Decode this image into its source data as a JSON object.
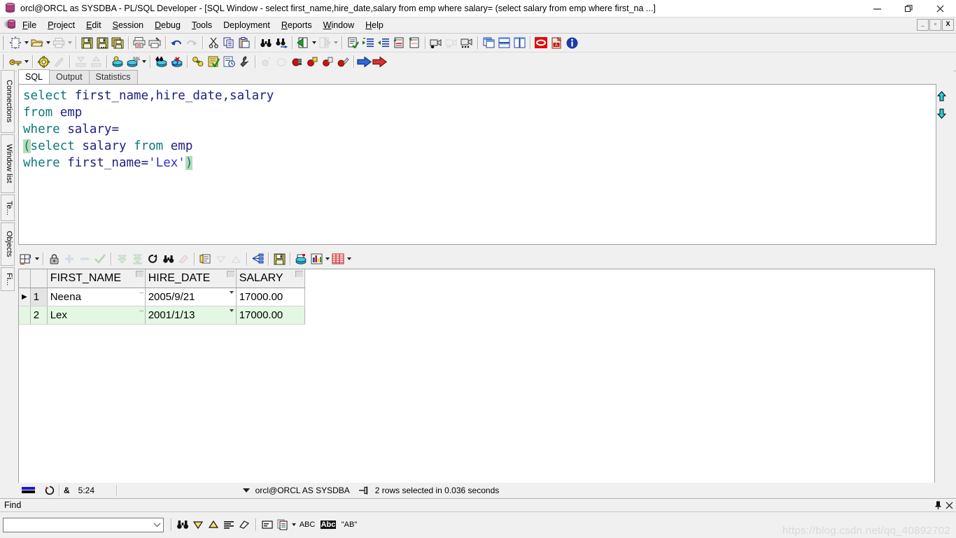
{
  "window": {
    "title": "orcl@ORCL as SYSDBA - PL/SQL Developer - [SQL Window - select first_name,hire_date,salary from emp where salary= (select salary from emp where first_na ...]",
    "minimize_label": "─",
    "restore_label": "❐",
    "close_label": "✕",
    "mdi_minimize": "_",
    "mdi_restore": "▫",
    "mdi_close": "X"
  },
  "menu": {
    "items": [
      {
        "label": "File",
        "accel": "F"
      },
      {
        "label": "Project",
        "accel": "P"
      },
      {
        "label": "Edit",
        "accel": "E"
      },
      {
        "label": "Session",
        "accel": "S"
      },
      {
        "label": "Debug",
        "accel": "D"
      },
      {
        "label": "Tools",
        "accel": "T"
      },
      {
        "label": "Deployment",
        "accel": ""
      },
      {
        "label": "Reports",
        "accel": "R"
      },
      {
        "label": "Window",
        "accel": "W"
      },
      {
        "label": "Help",
        "accel": "H"
      }
    ]
  },
  "toolbar_row1": [
    {
      "icon": "new-window-icon",
      "enabled": true,
      "dropdown": true
    },
    {
      "icon": "open-folder-icon",
      "enabled": true,
      "dropdown": true
    },
    {
      "icon": "print-icon",
      "enabled": false,
      "dropdown": true
    },
    {
      "sep": true
    },
    {
      "icon": "save-icon",
      "enabled": true
    },
    {
      "icon": "save-as-icon",
      "enabled": true
    },
    {
      "icon": "save-all-icon",
      "enabled": true
    },
    {
      "sep": true
    },
    {
      "icon": "print-preview-icon",
      "enabled": true
    },
    {
      "icon": "print-setup-icon",
      "enabled": true
    },
    {
      "sep": true
    },
    {
      "icon": "undo-icon",
      "enabled": true
    },
    {
      "icon": "redo-icon",
      "enabled": false
    },
    {
      "sep": true
    },
    {
      "icon": "cut-icon",
      "enabled": true
    },
    {
      "icon": "copy-icon",
      "enabled": true
    },
    {
      "icon": "paste-icon",
      "enabled": true
    },
    {
      "sep": true
    },
    {
      "icon": "find-icon",
      "enabled": true
    },
    {
      "icon": "find-next-icon",
      "enabled": true
    },
    {
      "sep": true
    },
    {
      "icon": "previous-window-icon",
      "enabled": true,
      "dropdown": true
    },
    {
      "icon": "next-window-icon",
      "enabled": false,
      "dropdown": true
    },
    {
      "sep": true
    },
    {
      "icon": "check-syntax-icon",
      "enabled": true
    },
    {
      "icon": "indent-icon",
      "enabled": true
    },
    {
      "icon": "outdent-icon",
      "enabled": true
    },
    {
      "icon": "comment-icon",
      "enabled": true
    },
    {
      "icon": "uncomment-icon",
      "enabled": true
    },
    {
      "sep": true
    },
    {
      "icon": "record-macro-icon",
      "enabled": true
    },
    {
      "icon": "pause-macro-icon",
      "enabled": false
    },
    {
      "icon": "play-macro-icon",
      "enabled": true
    },
    {
      "sep": true
    },
    {
      "icon": "cascade-windows-icon",
      "enabled": true
    },
    {
      "icon": "tile-horizontal-icon",
      "enabled": true
    },
    {
      "icon": "tile-vertical-icon",
      "enabled": true
    },
    {
      "sep": true
    },
    {
      "icon": "oracle-icon",
      "enabled": true
    },
    {
      "icon": "pdf-export-icon",
      "enabled": true
    },
    {
      "icon": "about-info-icon",
      "enabled": true
    }
  ],
  "toolbar_row2": [
    {
      "icon": "key-login-icon",
      "enabled": true,
      "dropdown": true
    },
    {
      "sep": true
    },
    {
      "icon": "preferences-gear-icon",
      "enabled": true
    },
    {
      "icon": "beautifier-icon",
      "enabled": false
    },
    {
      "sep": true
    },
    {
      "icon": "import-icon",
      "enabled": false
    },
    {
      "icon": "export-icon",
      "enabled": false
    },
    {
      "sep": true
    },
    {
      "icon": "new-sql-window-icon",
      "enabled": true
    },
    {
      "icon": "sql-window-icon",
      "enabled": true,
      "dropdown": true
    },
    {
      "sep": true
    },
    {
      "icon": "explain-plan-icon",
      "enabled": true
    },
    {
      "icon": "rollback-icon",
      "enabled": true
    },
    {
      "sep": true
    },
    {
      "icon": "object-browser-icon",
      "enabled": true
    },
    {
      "icon": "test-script-icon",
      "enabled": true
    },
    {
      "icon": "session-history-icon",
      "enabled": true
    },
    {
      "icon": "tools-wrench-icon",
      "enabled": true
    },
    {
      "sep": true
    },
    {
      "icon": "breakpoint-add-icon",
      "enabled": false
    },
    {
      "icon": "breakpoint-clear-icon",
      "enabled": false
    },
    {
      "icon": "breakpoints-icon",
      "enabled": true
    },
    {
      "icon": "breakpoint-file-icon",
      "enabled": true
    },
    {
      "icon": "breakpoint-copy-icon",
      "enabled": true
    },
    {
      "icon": "breakpoint-edit-icon",
      "enabled": true
    },
    {
      "sep": true
    },
    {
      "icon": "step-into-icon",
      "enabled": true
    },
    {
      "icon": "run-icon",
      "enabled": true
    }
  ],
  "sidebar": {
    "items": [
      {
        "label": "Connections"
      },
      {
        "label": "Window list"
      },
      {
        "label": "Te..."
      },
      {
        "label": "Objects"
      },
      {
        "label": "Fi..."
      }
    ]
  },
  "editor": {
    "tabs": [
      {
        "label": "SQL",
        "active": true
      },
      {
        "label": "Output",
        "active": false
      },
      {
        "label": "Statistics",
        "active": false
      }
    ],
    "sql_lines": [
      [
        {
          "t": "select ",
          "c": "kw"
        },
        {
          "t": "first_name",
          "c": "id"
        },
        {
          "t": ",",
          "c": "id"
        },
        {
          "t": "hire_date",
          "c": "id"
        },
        {
          "t": ",",
          "c": "id"
        },
        {
          "t": "salary",
          "c": "id"
        }
      ],
      [
        {
          "t": "from ",
          "c": "kw"
        },
        {
          "t": "emp",
          "c": "id"
        }
      ],
      [
        {
          "t": "where ",
          "c": "kw"
        },
        {
          "t": "salary",
          "c": "id"
        },
        {
          "t": "=",
          "c": "id"
        }
      ],
      [
        {
          "t": "(",
          "c": "par"
        },
        {
          "t": "select ",
          "c": "kw"
        },
        {
          "t": "salary ",
          "c": "id"
        },
        {
          "t": "from ",
          "c": "kw"
        },
        {
          "t": "emp",
          "c": "id"
        }
      ],
      [
        {
          "t": "where ",
          "c": "kw"
        },
        {
          "t": "first_name",
          "c": "id"
        },
        {
          "t": "=",
          "c": "id"
        },
        {
          "t": "'Lex'",
          "c": "str"
        },
        {
          "t": ")",
          "c": "par"
        }
      ]
    ],
    "sql_plain": "select first_name,hire_date,salary\nfrom emp\nwhere salary=\n(select salary from emp\nwhere first_name='Lex')",
    "scroll_up_icon": "scroll-up-arrow-icon",
    "scroll_down_icon": "scroll-down-arrow-icon"
  },
  "grid_toolbar": [
    {
      "icon": "grid-layout-icon",
      "enabled": true,
      "dropdown": true
    },
    {
      "sep": true
    },
    {
      "icon": "lock-record-icon",
      "enabled": true
    },
    {
      "icon": "insert-record-icon",
      "enabled": false
    },
    {
      "icon": "delete-record-icon",
      "enabled": false
    },
    {
      "icon": "post-changes-icon",
      "enabled": false
    },
    {
      "sep": true
    },
    {
      "icon": "fetch-next-page-icon",
      "enabled": false
    },
    {
      "icon": "fetch-last-page-icon",
      "enabled": false
    },
    {
      "icon": "refresh-icon",
      "enabled": true
    },
    {
      "icon": "find-in-grid-icon",
      "enabled": true
    },
    {
      "icon": "clear-filter-icon",
      "enabled": false
    },
    {
      "sep": true
    },
    {
      "icon": "copy-to-clipboard-icon",
      "enabled": true
    },
    {
      "icon": "sort-descending-icon",
      "enabled": false
    },
    {
      "icon": "sort-ascending-icon",
      "enabled": false
    },
    {
      "sep": true
    },
    {
      "icon": "query-data-icon",
      "enabled": true
    },
    {
      "sep": true
    },
    {
      "icon": "save-grid-icon",
      "enabled": true
    },
    {
      "sep": true
    },
    {
      "icon": "export-query-results-icon",
      "enabled": true
    },
    {
      "icon": "chart-icon",
      "enabled": true,
      "dropdown": true
    },
    {
      "icon": "grid-view-icon",
      "enabled": true,
      "dropdown": true
    }
  ],
  "results": {
    "columns": [
      "FIRST_NAME",
      "HIRE_DATE",
      "SALARY"
    ],
    "rows": [
      {
        "num": "1",
        "selected": true,
        "cells": [
          "Neena",
          "2005/9/21",
          "17000.00"
        ]
      },
      {
        "num": "2",
        "selected": false,
        "cells": [
          "Lex",
          "2001/1/13",
          "17000.00"
        ]
      }
    ],
    "current_row_marker": "▶"
  },
  "statusbar": {
    "mode_icon": "insert-mode-icon",
    "refresh_icon": "refresh-session-icon",
    "lock_icon": "ampersand-icon",
    "lock_label": "&",
    "cursor_position": "5:24",
    "connection_dropdown_icon": "chevron-down-icon",
    "connection": "orcl@ORCL AS SYSDBA",
    "pin_icon": "pin-session-icon",
    "message": "2 rows selected in 0.036 seconds"
  },
  "find_panel": {
    "title": "Find",
    "pin_icon": "pin-icon",
    "close_icon": "close-icon",
    "search_value": "",
    "search_placeholder": "",
    "dropdown_icon": "chevron-down-icon",
    "buttons": [
      {
        "icon": "find-binoculars-icon",
        "label": ""
      },
      {
        "icon": "find-down-icon",
        "label": ""
      },
      {
        "icon": "find-up-icon",
        "label": ""
      },
      {
        "icon": "find-all-icon",
        "label": ""
      },
      {
        "icon": "clear-highlight-icon",
        "label": ""
      },
      {
        "sep": true
      },
      {
        "icon": "find-in-window-icon",
        "label": ""
      },
      {
        "icon": "find-in-files-icon",
        "label": "",
        "dropdown": true
      },
      {
        "icon": "abc-text-icon",
        "label": "ABC"
      },
      {
        "icon": "match-case-icon",
        "label": "Abc"
      },
      {
        "icon": "whole-word-icon",
        "label": "\"AB\""
      }
    ]
  },
  "watermark": {
    "text": "https://blog.csdn.net/qq_40892702"
  },
  "colors": {
    "keyword": "#0d7878",
    "identifier": "#202080",
    "string": "#3232c8",
    "bracket_match_bg": "#b6dcb6",
    "alt_row_bg": "#e3f7e3",
    "window_bg": "#f0f0f0"
  }
}
